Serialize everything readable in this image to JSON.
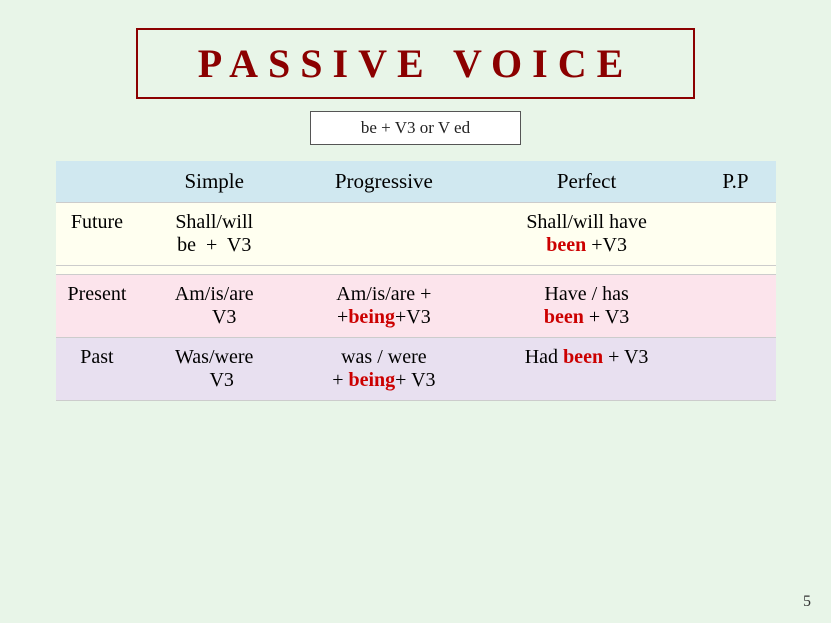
{
  "title": "PASSIVE   VOICE",
  "formula": "be + V3 or V ed",
  "header": {
    "col0": "",
    "col1": "Simple",
    "col2": "Progressive",
    "col3": "Perfect",
    "col4": "P.P"
  },
  "rows": [
    {
      "label": "Future",
      "simple": "Shall/will\n be  +  V3",
      "progressive": "",
      "perfect_prefix": "Shall/will have",
      "perfect_red": "been",
      "perfect_suffix": "+V3",
      "pp": ""
    },
    {
      "label": "Present",
      "simple": "Am/is/are\n V3",
      "progressive_prefix": "Am/is/are +\n+",
      "progressive_red": "being",
      "progressive_suffix": "+V3",
      "perfect_prefix": "Have / has",
      "perfect_red": "been",
      "perfect_suffix": "+ V3",
      "pp": ""
    },
    {
      "label": "Past",
      "simple": "Was/were\n V3",
      "progressive_prefix": "was / were\n + ",
      "progressive_red": "being",
      "progressive_suffix": "+ V3",
      "perfect_prefix": "Had ",
      "perfect_red": "been",
      "perfect_suffix": "+ V3",
      "pp": ""
    }
  ],
  "page_number": "5"
}
